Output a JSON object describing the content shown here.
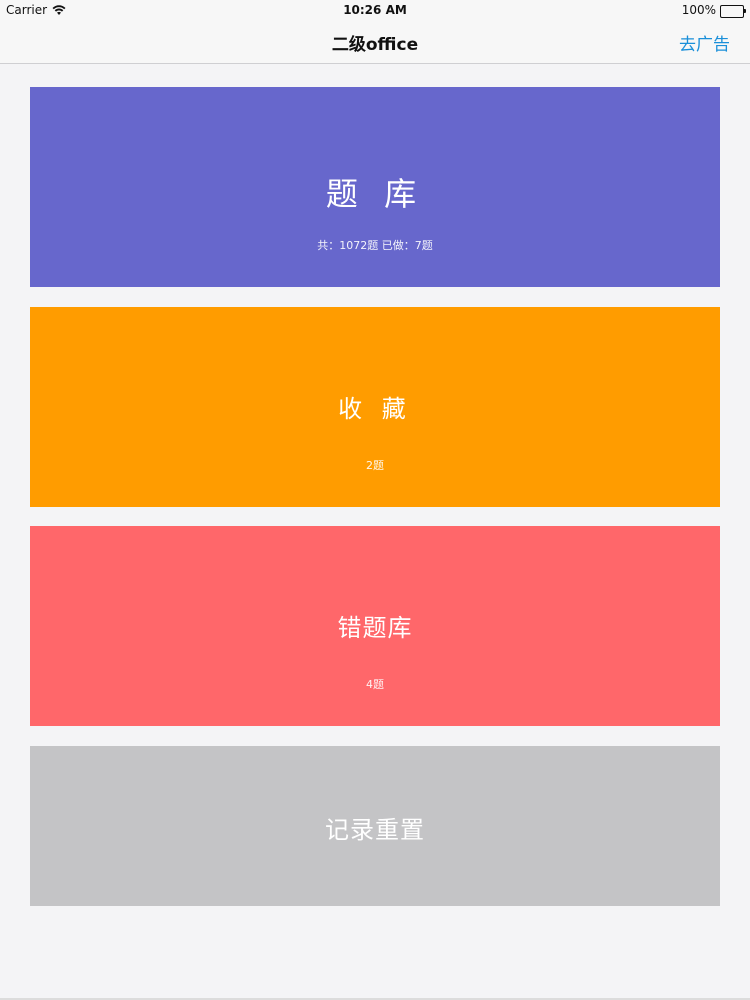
{
  "status_bar": {
    "carrier": "Carrier",
    "time": "10:26 AM",
    "battery": "100%",
    "wifi_icon": "wifi-icon",
    "battery_icon": "battery-icon"
  },
  "nav": {
    "title": "二级office",
    "action_label": "去广告"
  },
  "cards": {
    "question_bank": {
      "title": "题 库",
      "subtitle": "共：1072题  已做：7题",
      "color": "#6767cc"
    },
    "favorites": {
      "title": "收 藏",
      "subtitle": "2题",
      "color": "#ff9c00"
    },
    "wrong_questions": {
      "title": "错题库",
      "subtitle": "4题",
      "color": "#ff676a"
    },
    "reset_records": {
      "title": "记录重置",
      "color": "#c4c4c6"
    }
  },
  "colors": {
    "accent": "#1a8fd9",
    "background": "#f4f4f6"
  }
}
